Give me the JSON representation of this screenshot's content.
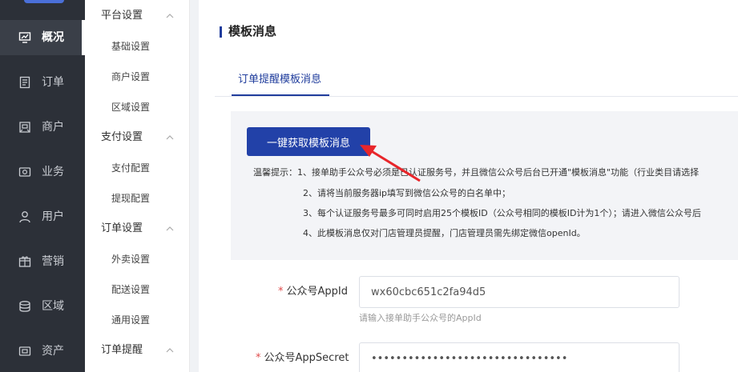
{
  "nav": {
    "items": [
      {
        "label": "概况",
        "icon": "overview-icon",
        "active": true
      },
      {
        "label": "订单",
        "icon": "order-icon"
      },
      {
        "label": "商户",
        "icon": "merchant-icon"
      },
      {
        "label": "业务",
        "icon": "business-icon"
      },
      {
        "label": "用户",
        "icon": "user-icon"
      },
      {
        "label": "营销",
        "icon": "marketing-icon"
      },
      {
        "label": "区域",
        "icon": "region-icon"
      },
      {
        "label": "资产",
        "icon": "asset-icon"
      }
    ]
  },
  "submenu": {
    "groups": [
      {
        "label": "平台设置",
        "items": [
          "基础设置",
          "商户设置",
          "区域设置"
        ]
      },
      {
        "label": "支付设置",
        "items": [
          "支付配置",
          "提现配置"
        ]
      },
      {
        "label": "订单设置",
        "items": [
          "外卖设置",
          "配送设置",
          "通用设置"
        ]
      },
      {
        "label": "订单提醒",
        "items": []
      }
    ]
  },
  "main": {
    "title": "模板消息",
    "tabs": [
      {
        "label": "订单提醒模板消息",
        "active": true
      }
    ],
    "fetch_button": "一键获取模板消息",
    "tips": [
      "温馨提示：1、接单助手公众号必须是已认证服务号，并且微信公众号后台已开通\"模板消息\"功能（行业类目请选择",
      "2、请将当前服务器ip填写到微信公众号的白名单中；",
      "3、每个认证服务号最多可同时启用25个模板ID（公众号相同的模板ID计为1个）；请进入微信公众号后",
      "4、此模板消息仅对门店管理员提醒，门店管理员需先绑定微信openId。"
    ],
    "form": {
      "appid_label": "公众号AppId",
      "appid_value": "wx60cbc651c2fa94d5",
      "appid_hint": "请输入接单助手公众号的AppId",
      "secret_label": "公众号AppSecret",
      "secret_value": "••••••••••••••••••••••••••••••••"
    },
    "accent_color": "#1f3c9c",
    "annotation_color": "#e8262b"
  }
}
